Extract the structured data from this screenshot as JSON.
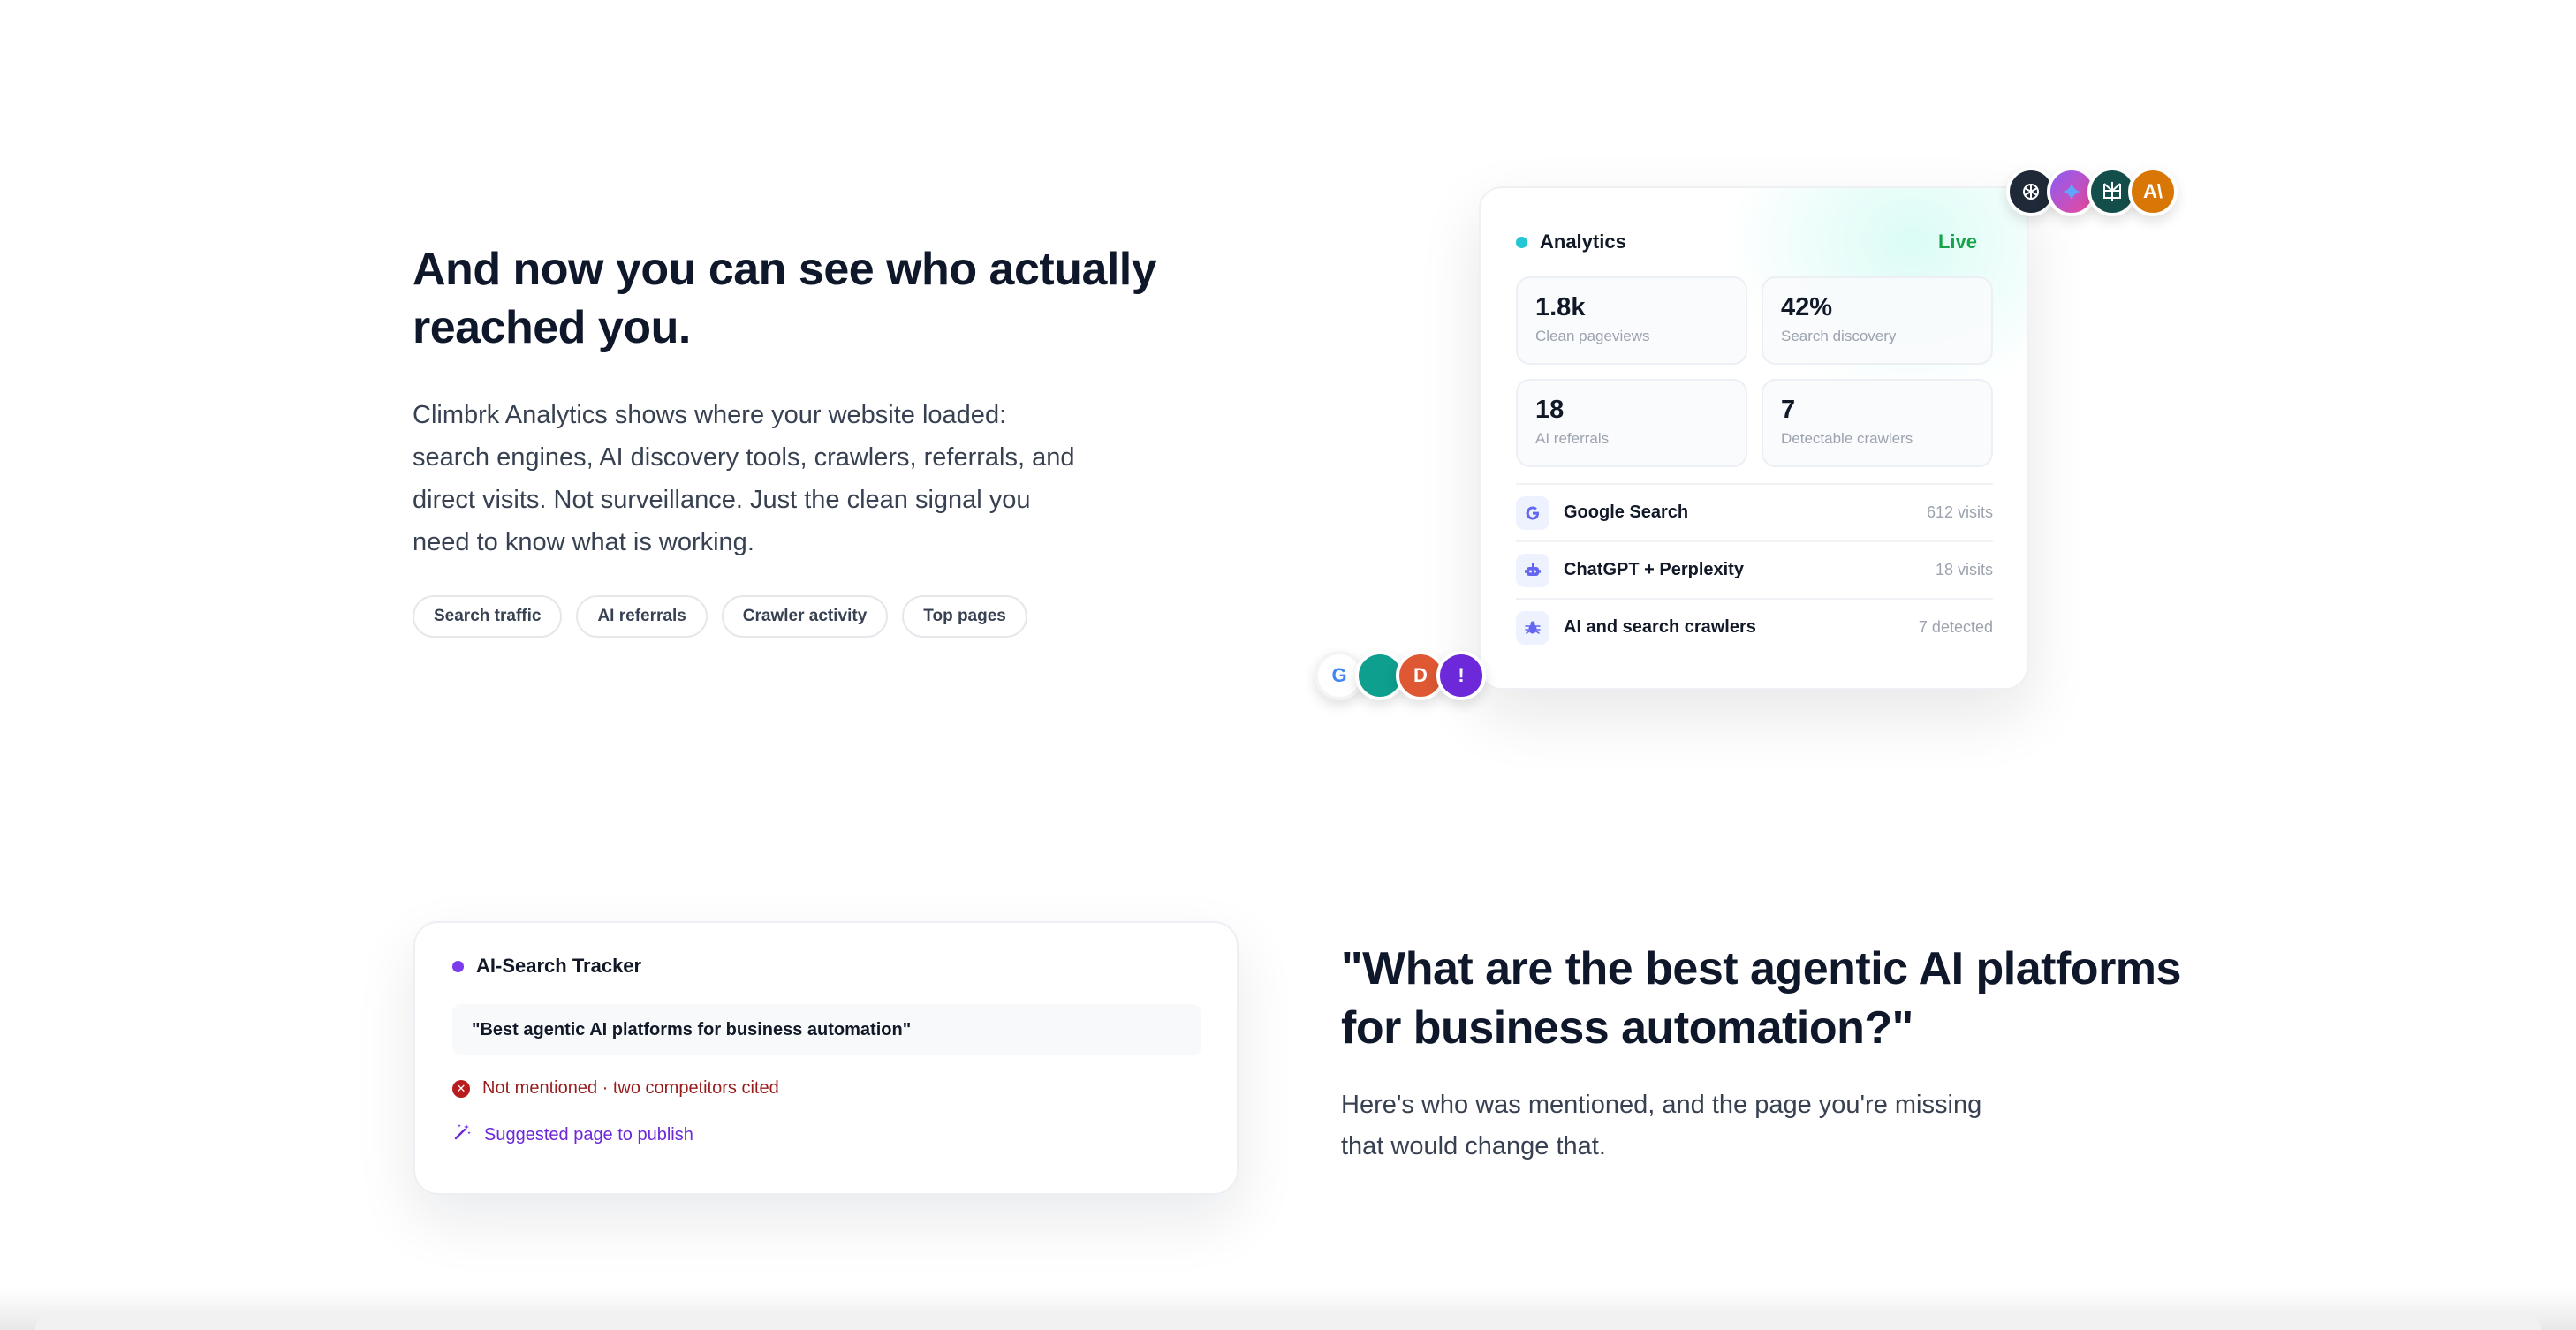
{
  "hero": {
    "title": "And now you can see who actually reached you.",
    "description": "Climbrk Analytics shows where your website loaded: search engines, AI discovery tools, crawlers, referrals, and direct visits. Not surveillance. Just the clean signal you need to know what is working.",
    "chips": [
      "Search traffic",
      "AI referrals",
      "Crawler activity",
      "Top pages"
    ]
  },
  "analytics": {
    "title": "Analytics",
    "status": "Live",
    "stats": [
      {
        "value": "1.8k",
        "label": "Clean pageviews"
      },
      {
        "value": "42%",
        "label": "Search discovery"
      },
      {
        "value": "18",
        "label": "AI referrals"
      },
      {
        "value": "7",
        "label": "Detectable crawlers"
      }
    ],
    "rows": [
      {
        "name": "Google Search",
        "meta": "612 visits",
        "icon": "google-g-icon"
      },
      {
        "name": "ChatGPT + Perplexity",
        "meta": "18 visits",
        "icon": "robot-icon"
      },
      {
        "name": "AI and search crawlers",
        "meta": "7 detected",
        "icon": "bug-icon"
      }
    ],
    "top_avatars": [
      "openai-icon",
      "gemini-icon",
      "perplexity-icon",
      "anthropic-icon"
    ],
    "bottom_avatars": [
      "google-icon",
      "teal-engine-icon",
      "duckduckgo-icon",
      "yahoo-icon"
    ],
    "top_avatar_text": [
      "",
      "",
      "",
      "A\\"
    ],
    "bottom_avatar_text": [
      "G",
      "",
      "D",
      "!"
    ]
  },
  "tracker": {
    "title": "AI-Search Tracker",
    "query": "\"Best agentic AI platforms for business automation\"",
    "status": "Not mentioned · two competitors cited",
    "suggestion": "Suggested page to publish"
  },
  "section2": {
    "title": "\"What are the best agentic AI platforms for business automation?\"",
    "description": "Here's who was mentioned, and the page you're missing that would change that."
  },
  "colors": {
    "analytics_dot": "#22c7d6",
    "live": "#16a34a",
    "tracker_dot": "#7c3aed",
    "error": "#b91c1c",
    "suggestion": "#6d28d9"
  }
}
